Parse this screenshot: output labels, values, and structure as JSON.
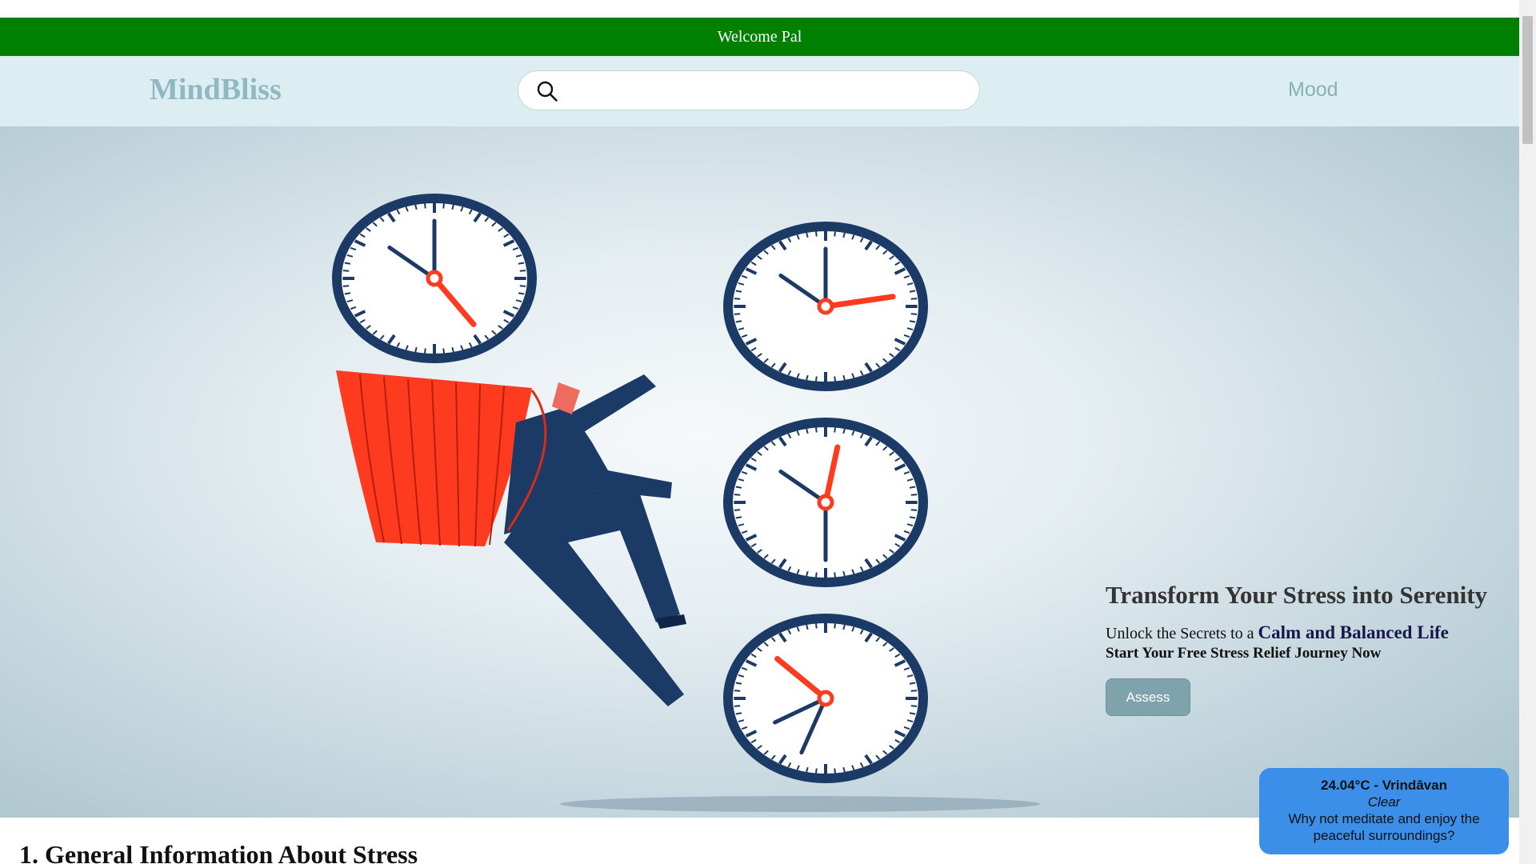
{
  "welcome_bar": {
    "text": "Welcome Pal"
  },
  "navbar": {
    "brand": "MindBliss",
    "search": {
      "placeholder": "",
      "value": ""
    },
    "mood_link": "Mood"
  },
  "hero": {
    "title": "Transform Your Stress into Serenity",
    "subtitle_prefix": "Unlock the Secrets to a ",
    "subtitle_accent": "Calm and Balanced Life",
    "cta_text": "Start Your Free Stress Relief Journey Now",
    "assess_button": "Assess",
    "illustration": "clocks-businessman-climbing-illustration"
  },
  "section": {
    "heading": "1. General Information About Stress"
  },
  "weather_widget": {
    "temperature_location": "24.04°C - Vrindāvan",
    "condition": "Clear",
    "suggestion": "Why not meditate and enjoy the peaceful surroundings?"
  },
  "colors": {
    "welcome_bar": "#008000",
    "navbar_bg": "#ddeef2",
    "brand": "#8fb8c0",
    "assess_button": "#7fa3ad",
    "weather_bg": "#3b8fe8",
    "clock_navy": "#1c3a66",
    "clock_red": "#ff3b1f"
  }
}
